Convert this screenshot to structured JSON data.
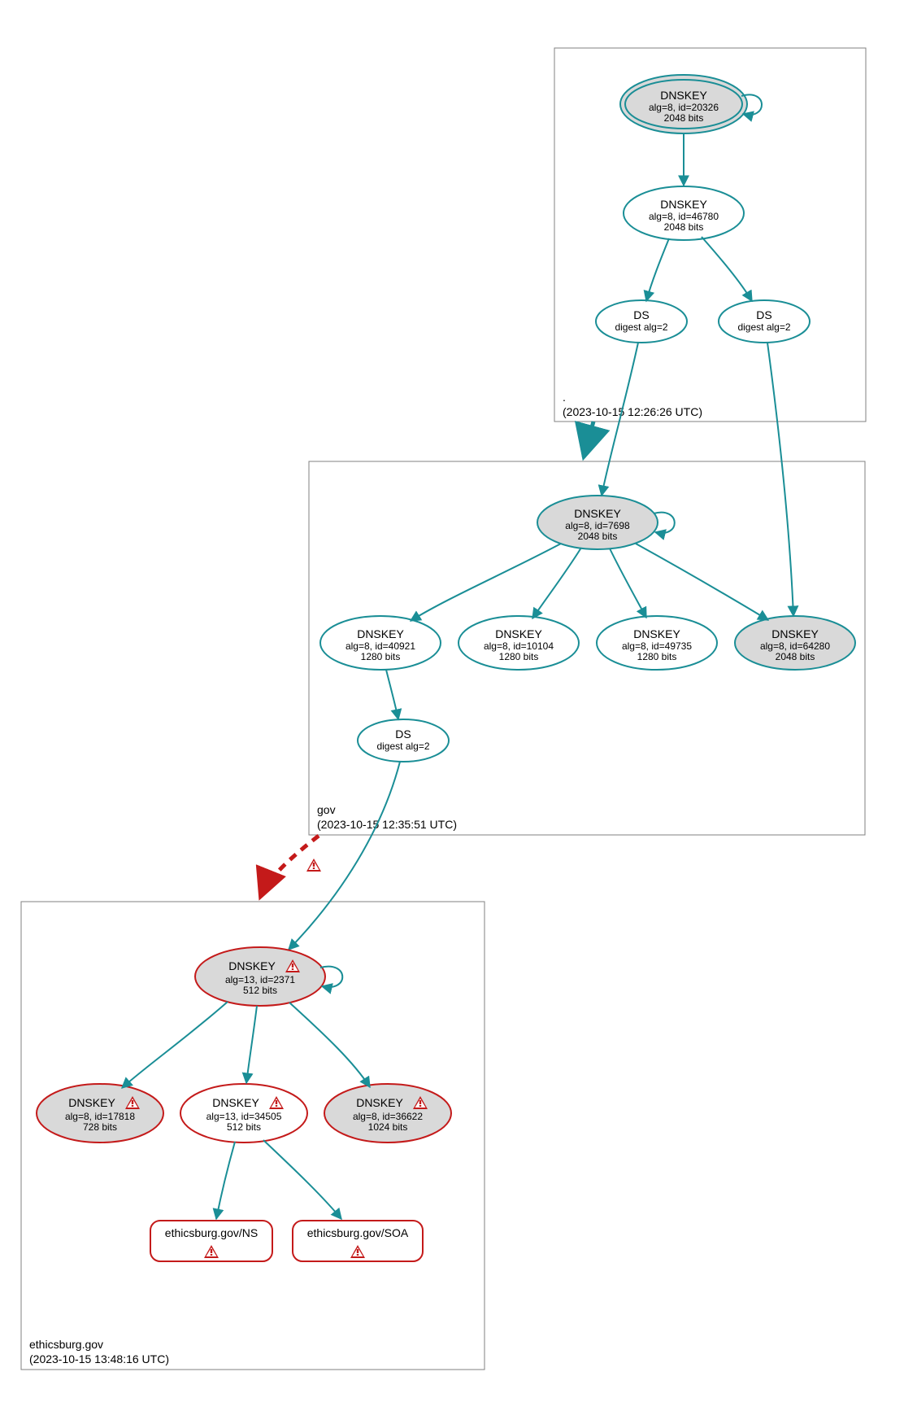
{
  "colors": {
    "teal": "#1a8e96",
    "red": "#c41a1a",
    "grayFill": "#d9d9d9",
    "boxStroke": "#808080"
  },
  "zones": {
    "root": {
      "label": ".",
      "timestamp": "(2023-10-15 12:26:26 UTC)"
    },
    "gov": {
      "label": "gov",
      "timestamp": "(2023-10-15 12:35:51 UTC)"
    },
    "ethicsburg": {
      "label": "ethicsburg.gov",
      "timestamp": "(2023-10-15 13:48:16 UTC)"
    }
  },
  "nodes": {
    "root_ksk": {
      "title": "DNSKEY",
      "line1": "alg=8, id=20326",
      "line2": "2048 bits"
    },
    "root_zsk": {
      "title": "DNSKEY",
      "line1": "alg=8, id=46780",
      "line2": "2048 bits"
    },
    "root_ds1": {
      "title": "DS",
      "line1": "digest alg=2"
    },
    "root_ds2": {
      "title": "DS",
      "line1": "digest alg=2"
    },
    "gov_ksk": {
      "title": "DNSKEY",
      "line1": "alg=8, id=7698",
      "line2": "2048 bits"
    },
    "gov_k1": {
      "title": "DNSKEY",
      "line1": "alg=8, id=40921",
      "line2": "1280 bits"
    },
    "gov_k2": {
      "title": "DNSKEY",
      "line1": "alg=8, id=10104",
      "line2": "1280 bits"
    },
    "gov_k3": {
      "title": "DNSKEY",
      "line1": "alg=8, id=49735",
      "line2": "1280 bits"
    },
    "gov_k4": {
      "title": "DNSKEY",
      "line1": "alg=8, id=64280",
      "line2": "2048 bits"
    },
    "gov_ds": {
      "title": "DS",
      "line1": "digest alg=2"
    },
    "eb_ksk": {
      "title": "DNSKEY",
      "line1": "alg=13, id=2371",
      "line2": "512 bits"
    },
    "eb_k1": {
      "title": "DNSKEY",
      "line1": "alg=8, id=17818",
      "line2": "728 bits"
    },
    "eb_k2": {
      "title": "DNSKEY",
      "line1": "alg=13, id=34505",
      "line2": "512 bits"
    },
    "eb_k3": {
      "title": "DNSKEY",
      "line1": "alg=8, id=36622",
      "line2": "1024 bits"
    },
    "eb_ns": {
      "title": "ethicsburg.gov/NS"
    },
    "eb_soa": {
      "title": "ethicsburg.gov/SOA"
    }
  }
}
